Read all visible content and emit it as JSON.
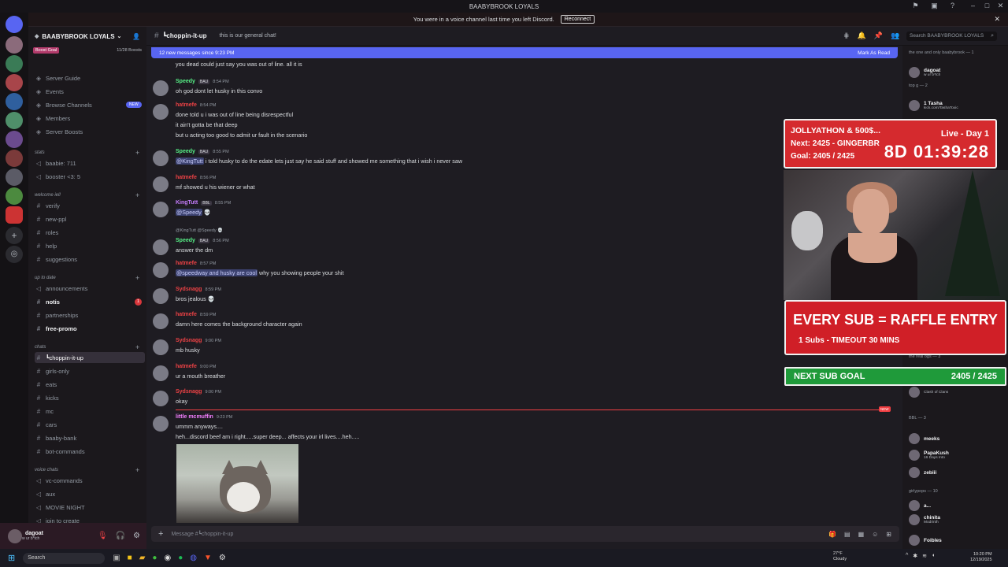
{
  "window": {
    "title": "BAABYBROOK LOYALS"
  },
  "notice": {
    "text": "You were in a voice channel last time you left Discord.",
    "button": "Reconnect"
  },
  "server": {
    "name": "BAABYBROOK LOYALS",
    "boost_goal": "Boost Goal",
    "boost_count": "11/28 Boosts"
  },
  "channels": {
    "top": [
      {
        "label": "Server Guide",
        "icon": "compass-icon"
      },
      {
        "label": "Events",
        "icon": "calendar-icon"
      },
      {
        "label": "Browse Channels",
        "icon": "list-icon",
        "badge": "NEW"
      },
      {
        "label": "Members",
        "icon": "people-icon"
      },
      {
        "label": "Server Boosts",
        "icon": "boost-icon"
      }
    ],
    "cats": [
      {
        "label": "stats",
        "items": [
          "baabie: 711",
          "booster <3: 5"
        ]
      },
      {
        "label": "welcome iell",
        "items": [
          "verify",
          "new-ppl",
          "roles",
          "help",
          "suggestions"
        ]
      },
      {
        "label": "up to date",
        "items": [
          "announcements",
          "notis",
          "partnerships",
          "free-promo"
        ]
      },
      {
        "label": "chats",
        "items": [
          "┗choppin-it-up",
          "girls-only",
          "eats",
          "kicks",
          "mc",
          "cars",
          "baaby-bank",
          "bot-commands"
        ]
      },
      {
        "label": "voice chats",
        "items": [
          "vc-commands",
          "aux",
          "MOVIE NIGHT",
          "join to create"
        ]
      }
    ],
    "notis_badge": "1"
  },
  "user": {
    "name": "dagoat",
    "status": "w ur b*tch"
  },
  "topbar": {
    "channel": "┗choppin-it-up",
    "topic": "this is our general chat!",
    "search_placeholder": "Search BAABYBROOK LOYALS"
  },
  "banner": {
    "text": "12 new messages since 9:23 PM",
    "action": "Mark As Read"
  },
  "messages": [
    {
      "author": "",
      "color": "#dbdee1",
      "time": "",
      "lines": [
        "you dead could just say you was out of line. all it is"
      ]
    },
    {
      "author": "Speedy",
      "color": "#57f287",
      "badge": "BAU",
      "time": "8:54 PM",
      "lines": [
        "oh god dont let husky in this convo"
      ]
    },
    {
      "author": "hatmefe",
      "color": "#ed4245",
      "time": "8:54 PM",
      "lines": [
        "done told u i was out of line being disrespectful",
        "it ain't gotta be that deep",
        "but u acting too good to admit ur fault in the scenario"
      ]
    },
    {
      "author": "Speedy",
      "color": "#57f287",
      "badge": "BAU",
      "time": "8:55 PM",
      "mention": "@KingTutt",
      "lines": [
        " i told husky to do the edate lets just say he said stuff and showed me something that i wish i never saw"
      ]
    },
    {
      "author": "hatmefe",
      "color": "#ed4245",
      "time": "8:56 PM",
      "lines": [
        "mf showed u his wiener or what"
      ]
    },
    {
      "author": "KingTutt",
      "color": "#c77dff",
      "badge": "BBL",
      "time": "8:55 PM",
      "mention": "@Speedy",
      "lines": [
        " 💀"
      ]
    },
    {
      "author": "Speedy",
      "color": "#57f287",
      "badge": "BAU",
      "time": "8:56 PM",
      "reply": "@KingTutt  @Speedy 💀",
      "lines": [
        "answer the dm"
      ]
    },
    {
      "author": "hatmefe",
      "color": "#ed4245",
      "time": "8:57 PM",
      "mention": "@speedway and husky are cool",
      "lines": [
        " why you showing people your shit"
      ]
    },
    {
      "author": "Sydsnagg",
      "color": "#ed4245",
      "time": "8:59 PM",
      "lines": [
        "bros jealous 💀"
      ]
    },
    {
      "author": "hatmefe",
      "color": "#ed4245",
      "time": "8:59 PM",
      "lines": [
        "damn here comes the background character again"
      ]
    },
    {
      "author": "Sydsnagg",
      "color": "#ed4245",
      "time": "9:00 PM",
      "lines": [
        "mb husky"
      ]
    },
    {
      "author": "hatmefe",
      "color": "#ed4245",
      "time": "9:00 PM",
      "lines": [
        "ur a mouth breather"
      ]
    },
    {
      "author": "Sydsnagg",
      "color": "#ed4245",
      "time": "9:00 PM",
      "lines": [
        "okay"
      ]
    },
    {
      "author": "little mcmuffin",
      "color": "#f47fff",
      "time": "9:23 PM",
      "lines": [
        "ummm anyways....",
        "heh...discord beef am i right.....super deep... affects your irl lives....heh....."
      ]
    }
  ],
  "new_tag": "NEW",
  "composer": {
    "placeholder": "Message #┗choppin-it-up"
  },
  "members": [
    {
      "group": "the one and only baabybrook — 1",
      "items": [
        {
          "name": "dagoat",
          "sub": "w ur b*tch"
        }
      ]
    },
    {
      "group": "top g — 2",
      "items": [
        {
          "name": "1 Tasha",
          "sub": "kick.com/TashaToxic"
        }
      ]
    },
    {
      "group": "the real ogs — 3",
      "items": [
        {
          "name": "",
          "sub": "Clash of Clans"
        }
      ]
    },
    {
      "group": "BBL — 3",
      "items": [
        {
          "name": "meeks",
          "sub": ""
        },
        {
          "name": "PapaKush",
          "sub": "16 Days Into"
        },
        {
          "name": "zebiii",
          "sub": ""
        }
      ]
    },
    {
      "group": "girlypops — 10",
      "items": [
        {
          "name": "a...",
          "sub": ""
        },
        {
          "name": "chinita",
          "sub": "Modrinth"
        },
        {
          "name": "Foibles",
          "sub": ""
        }
      ]
    }
  ],
  "overlay": {
    "title": "JOLLYATHON & 500$...",
    "next": "Next: 2425 - GINGERBR",
    "goal": "Goal: 2405 / 2425",
    "live": "Live - Day 1",
    "timer": "8D 01:39:28",
    "raffle": "EVERY SUB = RAFFLE ENTRY",
    "raffle_sub": "1 Subs - TIMEOUT 30 MINS",
    "next_goal": "NEXT SUB GOAL",
    "next_goal_value": "2405 / 2425"
  },
  "taskbar": {
    "search": "Search",
    "weather_temp": "27°F",
    "weather": "Cloudy",
    "time": "10:20 PM",
    "date": "12/19/2025"
  }
}
